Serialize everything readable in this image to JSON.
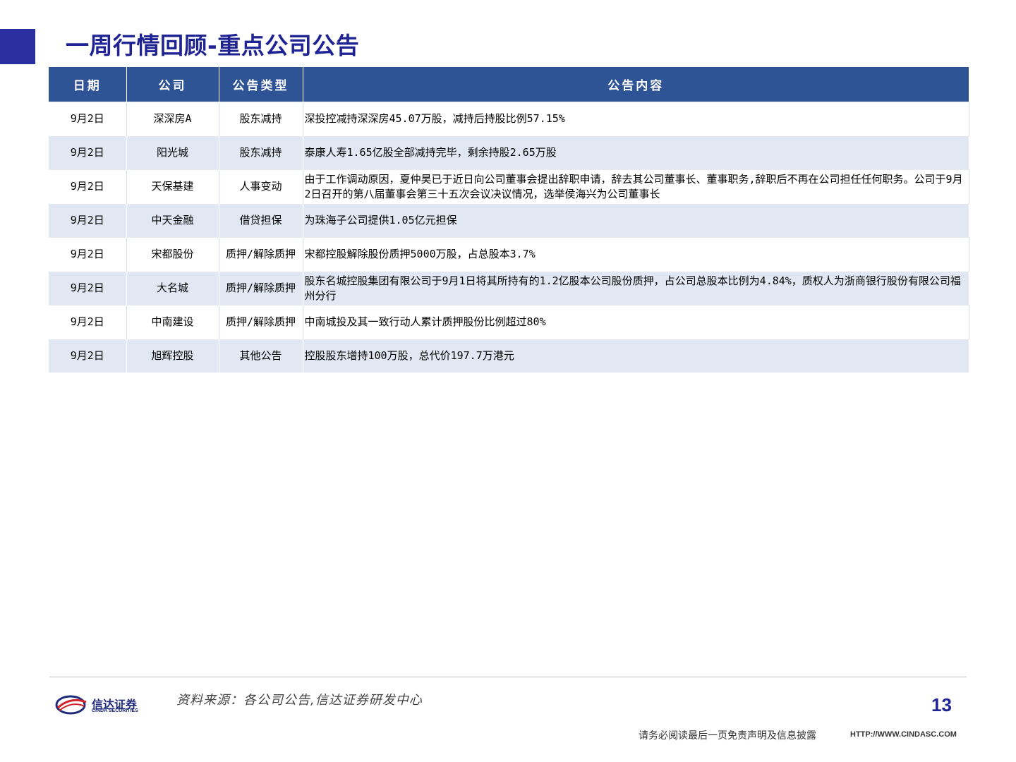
{
  "page": {
    "title": "一周行情回顾-重点公司公告",
    "page_number": "13"
  },
  "table": {
    "headers": [
      "日期",
      "公司",
      "公告类型",
      "公告内容"
    ],
    "rows": [
      {
        "date": "9月2日",
        "company": "深深房A",
        "type": "股东减持",
        "content": "深投控减持深深房45.07万股，减持后持股比例57.15%"
      },
      {
        "date": "9月2日",
        "company": "阳光城",
        "type": "股东减持",
        "content": "泰康人寿1.65亿股全部减持完毕，剩余持股2.65万股"
      },
      {
        "date": "9月2日",
        "company": "天保基建",
        "type": "人事变动",
        "content": "由于工作调动原因，夏仲昊已于近日向公司董事会提出辞职申请，辞去其公司董事长、董事职务,辞职后不再在公司担任任何职务。公司于9月2日召开的第八届董事会第三十五次会议决议情况，选举侯海兴为公司董事长"
      },
      {
        "date": "9月2日",
        "company": "中天金融",
        "type": "借贷担保",
        "content": "为珠海子公司提供1.05亿元担保"
      },
      {
        "date": "9月2日",
        "company": "宋都股份",
        "type": "质押/解除质押",
        "content": "宋都控股解除股份质押5000万股，占总股本3.7%"
      },
      {
        "date": "9月2日",
        "company": "大名城",
        "type": "质押/解除质押",
        "content": "股东名城控股集团有限公司于9月1日将其所持有的1.2亿股本公司股份质押，占公司总股本比例为4.84%，质权人为浙商银行股份有限公司福州分行"
      },
      {
        "date": "9月2日",
        "company": "中南建设",
        "type": "质押/解除质押",
        "content": "中南城投及其一致行动人累计质押股份比例超过80%"
      },
      {
        "date": "9月2日",
        "company": "旭辉控股",
        "type": "其他公告",
        "content": "控股股东增持100万股，总代价197.7万港元"
      }
    ]
  },
  "footer": {
    "logo_cn": "信达证券",
    "logo_en": "CINDA SECURITIES",
    "source": "资料来源：各公司公告,信达证券研发中心",
    "disclaimer": "请务必阅读最后一页免责声明及信息披露",
    "website": "HTTP://WWW.CINDASC.COM"
  },
  "colors": {
    "title": "#1f2393",
    "header_bg": "#2e5496",
    "row_alt_bg": "#e1e8f3",
    "corner_block": "#2c2fa0"
  }
}
